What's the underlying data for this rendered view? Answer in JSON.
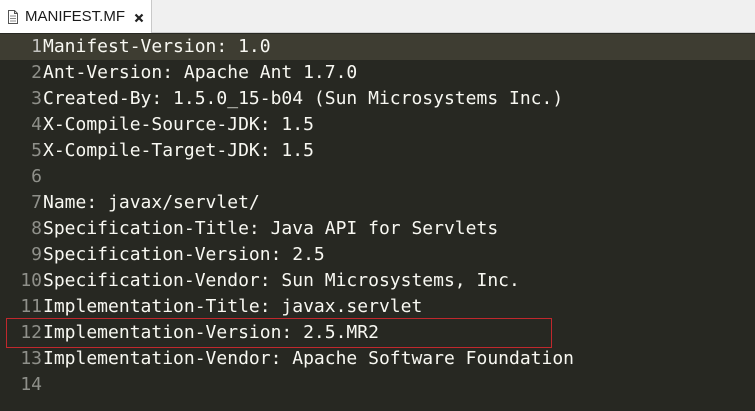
{
  "tab": {
    "title": "MANIFEST.MF",
    "file_icon": "document-icon",
    "close_icon": "close-icon"
  },
  "editor": {
    "current_line": 1,
    "highlighted_line": 12,
    "lines": [
      {
        "number": "1",
        "text": "Manifest-Version: 1.0"
      },
      {
        "number": "2",
        "text": "Ant-Version: Apache Ant 1.7.0"
      },
      {
        "number": "3",
        "text": "Created-By: 1.5.0_15-b04 (Sun Microsystems Inc.)"
      },
      {
        "number": "4",
        "text": "X-Compile-Source-JDK: 1.5"
      },
      {
        "number": "5",
        "text": "X-Compile-Target-JDK: 1.5"
      },
      {
        "number": "6",
        "text": ""
      },
      {
        "number": "7",
        "text": "Name: javax/servlet/"
      },
      {
        "number": "8",
        "text": "Specification-Title: Java API for Servlets"
      },
      {
        "number": "9",
        "text": "Specification-Version: 2.5"
      },
      {
        "number": "10",
        "text": "Specification-Vendor: Sun Microsystems, Inc."
      },
      {
        "number": "11",
        "text": "Implementation-Title: javax.servlet"
      },
      {
        "number": "12",
        "text": "Implementation-Version: 2.5.MR2"
      },
      {
        "number": "13",
        "text": "Implementation-Vendor: Apache Software Foundation"
      },
      {
        "number": "14",
        "text": ""
      }
    ]
  },
  "colors": {
    "background": "#272822",
    "current_line": "#3e3d32",
    "text": "#f8f8f2",
    "gutter_text": "#8f908a",
    "highlight_border": "#c0282d"
  }
}
